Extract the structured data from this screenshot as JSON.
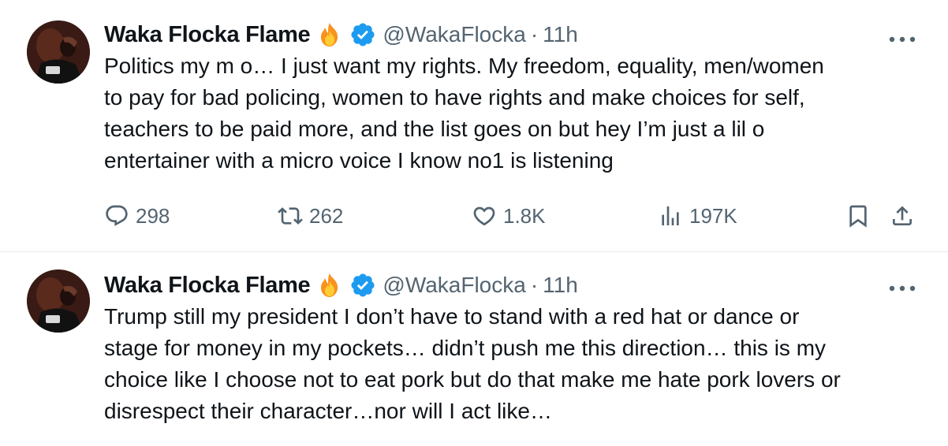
{
  "tweets": [
    {
      "author": {
        "display_name": "Waka Flocka Flame",
        "handle": "@WakaFlocka",
        "verified": true,
        "emoji_icon": "fire-icon"
      },
      "separator": "·",
      "time": "11h",
      "text_lines": [
        "Politics my m o… I just want my rights. My freedom, equality, men/women",
        "to pay for bad policing, women to have rights and make choices for self,",
        "teachers to be paid more, and the list goes on but hey I’m just a lil o",
        "entertainer with a micro voice I know no1 is listening"
      ],
      "stats": {
        "replies": "298",
        "reposts": "262",
        "likes": "1.8K",
        "views": "197K"
      }
    },
    {
      "author": {
        "display_name": "Waka Flocka Flame",
        "handle": "@WakaFlocka",
        "verified": true,
        "emoji_icon": "fire-icon"
      },
      "separator": "·",
      "time": "11h",
      "text_lines": [
        "Trump still my president I don’t have to stand with a red hat or dance or",
        "stage for money in my pockets… didn’t push me this direction… this is my",
        "choice like I choose not to eat pork but do that make me hate pork lovers or",
        "disrespect their character…nor will I act like…"
      ]
    }
  ],
  "colors": {
    "text": "#0f1419",
    "secondary": "#536471",
    "verified": "#1d9bf0",
    "divider": "#e6e9ec"
  },
  "icons": [
    "reply-icon",
    "repost-icon",
    "like-icon",
    "views-icon",
    "bookmark-icon",
    "share-icon",
    "more-icon",
    "verified-badge-icon",
    "fire-icon"
  ]
}
